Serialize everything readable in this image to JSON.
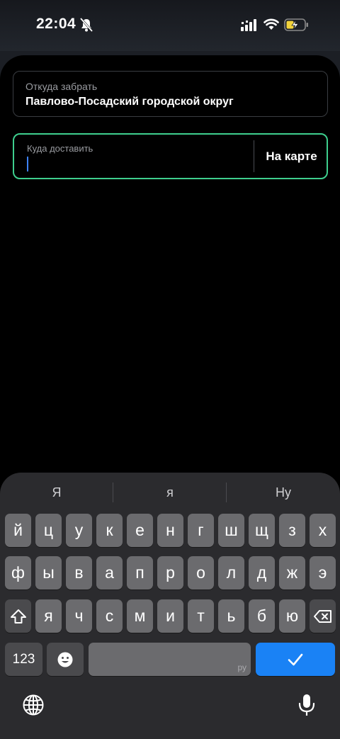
{
  "status_bar": {
    "time": "22:04",
    "icons": [
      "bell-slash-icon",
      "signal-icon",
      "wifi-icon",
      "battery-charging-icon"
    ]
  },
  "route": {
    "from": {
      "label": "Откуда забрать",
      "value": "Павлово-Посадский городской округ"
    },
    "to": {
      "label": "Куда доставить",
      "value": "",
      "map_button": "На карте"
    }
  },
  "keyboard": {
    "suggestions": [
      "Я",
      "я",
      "Ну"
    ],
    "rows": [
      [
        "й",
        "ц",
        "у",
        "к",
        "е",
        "н",
        "г",
        "ш",
        "щ",
        "з",
        "х"
      ],
      [
        "ф",
        "ы",
        "в",
        "а",
        "п",
        "р",
        "о",
        "л",
        "д",
        "ж",
        "э"
      ],
      [
        "я",
        "ч",
        "с",
        "м",
        "и",
        "т",
        "ь",
        "б",
        "ю"
      ]
    ],
    "numbers_key": "123",
    "space_lang": "ру",
    "icons": [
      "shift-icon",
      "backspace-icon",
      "emoji-icon",
      "checkmark-icon",
      "globe-icon",
      "microphone-icon"
    ]
  },
  "colors": {
    "accent_green": "#3ecf8e",
    "accent_blue": "#1a82f5",
    "caret": "#3d82ff"
  }
}
